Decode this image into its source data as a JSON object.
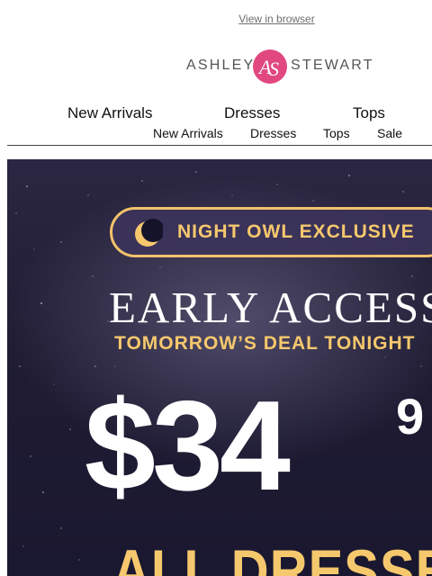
{
  "header": {
    "view_in_browser": "View in browser",
    "brand_left": "ASHLEY",
    "brand_right": "STEWART",
    "brand_mark": "AS",
    "brand_color": "#e0487f"
  },
  "nav_primary": [
    {
      "label": "New Arrivals"
    },
    {
      "label": "Dresses"
    },
    {
      "label": "Tops"
    }
  ],
  "nav_secondary": [
    {
      "label": "New Arrivals"
    },
    {
      "label": "Dresses"
    },
    {
      "label": "Tops"
    },
    {
      "label": "Sale"
    }
  ],
  "hero": {
    "badge": "NIGHT OWL EXCLUSIVE",
    "headline": "EARLY ACCESS",
    "subheadline": "TOMORROW’S DEAL TONIGHT",
    "price_main": "$34",
    "price_cents": "9",
    "offer": "ALL DRESSES",
    "gold_color": "#f6c86d",
    "bg_color": "#221f38"
  }
}
